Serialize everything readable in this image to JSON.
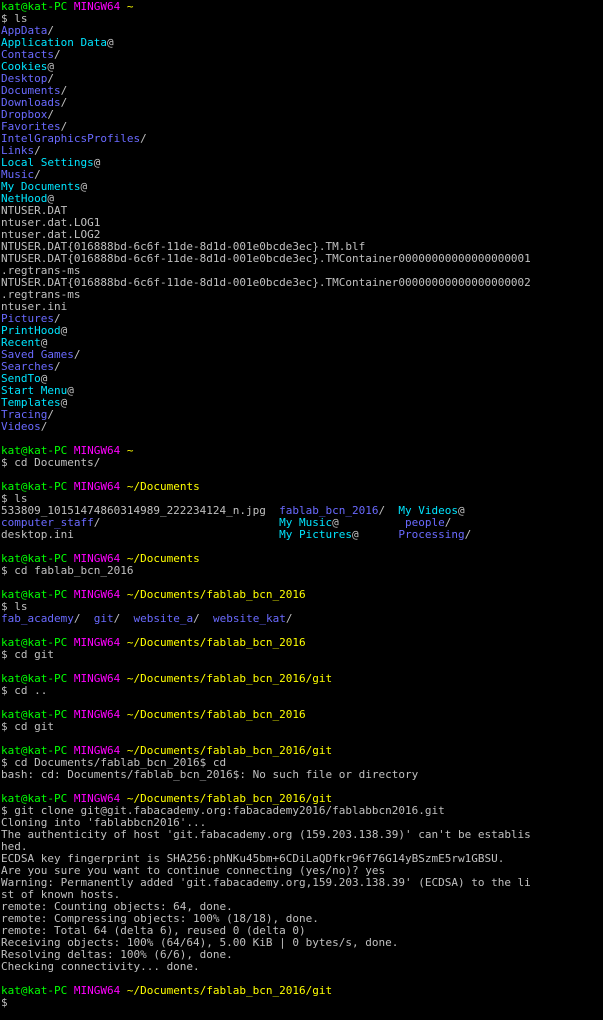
{
  "terminal": {
    "colors": {
      "background": "#000000",
      "text": "#c0c0c0",
      "user": "#00ff00",
      "mingw": "#ff00ff",
      "path": "#ffff00",
      "directory": "#6a6aff",
      "symlink": "#00e5ff"
    },
    "lines": [
      [
        [
          "kat@kat-PC ",
          "user"
        ],
        [
          "MINGW64 ",
          "mingw"
        ],
        [
          "~",
          "path"
        ]
      ],
      [
        [
          "$ ls",
          "txt"
        ]
      ],
      [
        [
          "AppData",
          "dir"
        ],
        [
          "/",
          "txt"
        ]
      ],
      [
        [
          "Application Data",
          "link"
        ],
        [
          "@",
          "txt"
        ]
      ],
      [
        [
          "Contacts",
          "dir"
        ],
        [
          "/",
          "txt"
        ]
      ],
      [
        [
          "Cookies",
          "link"
        ],
        [
          "@",
          "txt"
        ]
      ],
      [
        [
          "Desktop",
          "dir"
        ],
        [
          "/",
          "txt"
        ]
      ],
      [
        [
          "Documents",
          "dir"
        ],
        [
          "/",
          "txt"
        ]
      ],
      [
        [
          "Downloads",
          "dir"
        ],
        [
          "/",
          "txt"
        ]
      ],
      [
        [
          "Dropbox",
          "dir"
        ],
        [
          "/",
          "txt"
        ]
      ],
      [
        [
          "Favorites",
          "dir"
        ],
        [
          "/",
          "txt"
        ]
      ],
      [
        [
          "IntelGraphicsProfiles",
          "dir"
        ],
        [
          "/",
          "txt"
        ]
      ],
      [
        [
          "Links",
          "dir"
        ],
        [
          "/",
          "txt"
        ]
      ],
      [
        [
          "Local Settings",
          "link"
        ],
        [
          "@",
          "txt"
        ]
      ],
      [
        [
          "Music",
          "dir"
        ],
        [
          "/",
          "txt"
        ]
      ],
      [
        [
          "My Documents",
          "link"
        ],
        [
          "@",
          "txt"
        ]
      ],
      [
        [
          "NetHood",
          "link"
        ],
        [
          "@",
          "txt"
        ]
      ],
      [
        [
          "NTUSER.DAT",
          "txt"
        ]
      ],
      [
        [
          "ntuser.dat.LOG1",
          "txt"
        ]
      ],
      [
        [
          "ntuser.dat.LOG2",
          "txt"
        ]
      ],
      [
        [
          "NTUSER.DAT{016888bd-6c6f-11de-8d1d-001e0bcde3ec}.TM.blf",
          "txt"
        ]
      ],
      [
        [
          "NTUSER.DAT{016888bd-6c6f-11de-8d1d-001e0bcde3ec}.TMContainer00000000000000000001",
          "txt"
        ]
      ],
      [
        [
          ".regtrans-ms",
          "txt"
        ]
      ],
      [
        [
          "NTUSER.DAT{016888bd-6c6f-11de-8d1d-001e0bcde3ec}.TMContainer00000000000000000002",
          "txt"
        ]
      ],
      [
        [
          ".regtrans-ms",
          "txt"
        ]
      ],
      [
        [
          "ntuser.ini",
          "txt"
        ]
      ],
      [
        [
          "Pictures",
          "dir"
        ],
        [
          "/",
          "txt"
        ]
      ],
      [
        [
          "PrintHood",
          "link"
        ],
        [
          "@",
          "txt"
        ]
      ],
      [
        [
          "Recent",
          "link"
        ],
        [
          "@",
          "txt"
        ]
      ],
      [
        [
          "Saved Games",
          "dir"
        ],
        [
          "/",
          "txt"
        ]
      ],
      [
        [
          "Searches",
          "dir"
        ],
        [
          "/",
          "txt"
        ]
      ],
      [
        [
          "SendTo",
          "link"
        ],
        [
          "@",
          "txt"
        ]
      ],
      [
        [
          "Start Menu",
          "link"
        ],
        [
          "@",
          "txt"
        ]
      ],
      [
        [
          "Templates",
          "link"
        ],
        [
          "@",
          "txt"
        ]
      ],
      [
        [
          "Tracing",
          "dir"
        ],
        [
          "/",
          "txt"
        ]
      ],
      [
        [
          "Videos",
          "dir"
        ],
        [
          "/",
          "txt"
        ]
      ],
      [],
      [
        [
          "kat@kat-PC ",
          "user"
        ],
        [
          "MINGW64 ",
          "mingw"
        ],
        [
          "~",
          "path"
        ]
      ],
      [
        [
          "$ cd Documents/",
          "txt"
        ]
      ],
      [],
      [
        [
          "kat@kat-PC ",
          "user"
        ],
        [
          "MINGW64 ",
          "mingw"
        ],
        [
          "~/Documents",
          "path"
        ]
      ],
      [
        [
          "$ ls",
          "txt"
        ]
      ],
      [
        [
          "533809_10151474860314989_222234124_n.jpg  ",
          "txt"
        ],
        [
          "fablab_bcn_2016",
          "dir"
        ],
        [
          "/  ",
          "txt"
        ],
        [
          "My Videos",
          "link"
        ],
        [
          "@",
          "txt"
        ]
      ],
      [
        [
          "computer_staff",
          "dir"
        ],
        [
          "/                           ",
          "txt"
        ],
        [
          "My Music",
          "link"
        ],
        [
          "@          ",
          "txt"
        ],
        [
          "people",
          "dir"
        ],
        [
          "/",
          "txt"
        ]
      ],
      [
        [
          "desktop.ini                               ",
          "txt"
        ],
        [
          "My Pictures",
          "link"
        ],
        [
          "@      ",
          "txt"
        ],
        [
          "Processing",
          "dir"
        ],
        [
          "/",
          "txt"
        ]
      ],
      [],
      [
        [
          "kat@kat-PC ",
          "user"
        ],
        [
          "MINGW64 ",
          "mingw"
        ],
        [
          "~/Documents",
          "path"
        ]
      ],
      [
        [
          "$ cd fablab_bcn_2016",
          "txt"
        ]
      ],
      [],
      [
        [
          "kat@kat-PC ",
          "user"
        ],
        [
          "MINGW64 ",
          "mingw"
        ],
        [
          "~/Documents/fablab_bcn_2016",
          "path"
        ]
      ],
      [
        [
          "$ ls",
          "txt"
        ]
      ],
      [
        [
          "fab_academy",
          "dir"
        ],
        [
          "/  ",
          "txt"
        ],
        [
          "git",
          "dir"
        ],
        [
          "/  ",
          "txt"
        ],
        [
          "website_a",
          "dir"
        ],
        [
          "/  ",
          "txt"
        ],
        [
          "website_kat",
          "dir"
        ],
        [
          "/",
          "txt"
        ]
      ],
      [],
      [
        [
          "kat@kat-PC ",
          "user"
        ],
        [
          "MINGW64 ",
          "mingw"
        ],
        [
          "~/Documents/fablab_bcn_2016",
          "path"
        ]
      ],
      [
        [
          "$ cd git",
          "txt"
        ]
      ],
      [],
      [
        [
          "kat@kat-PC ",
          "user"
        ],
        [
          "MINGW64 ",
          "mingw"
        ],
        [
          "~/Documents/fablab_bcn_2016/git",
          "path"
        ]
      ],
      [
        [
          "$ cd ..",
          "txt"
        ]
      ],
      [],
      [
        [
          "kat@kat-PC ",
          "user"
        ],
        [
          "MINGW64 ",
          "mingw"
        ],
        [
          "~/Documents/fablab_bcn_2016",
          "path"
        ]
      ],
      [
        [
          "$ cd git",
          "txt"
        ]
      ],
      [],
      [
        [
          "kat@kat-PC ",
          "user"
        ],
        [
          "MINGW64 ",
          "mingw"
        ],
        [
          "~/Documents/fablab_bcn_2016/git",
          "path"
        ]
      ],
      [
        [
          "$ cd Documents/fablab_bcn_2016$ cd",
          "txt"
        ]
      ],
      [
        [
          "bash: cd: Documents/fablab_bcn_2016$: No such file or directory",
          "txt"
        ]
      ],
      [],
      [
        [
          "kat@kat-PC ",
          "user"
        ],
        [
          "MINGW64 ",
          "mingw"
        ],
        [
          "~/Documents/fablab_bcn_2016/git",
          "path"
        ]
      ],
      [
        [
          "$ git clone git@git.fabacademy.org:fabacademy2016/fablabbcn2016.git",
          "txt"
        ]
      ],
      [
        [
          "Cloning into 'fablabbcn2016'...",
          "txt"
        ]
      ],
      [
        [
          "The authenticity of host 'git.fabacademy.org (159.203.138.39)' can't be establis",
          "txt"
        ]
      ],
      [
        [
          "hed.",
          "txt"
        ]
      ],
      [
        [
          "ECDSA key fingerprint is SHA256:phNKu45bm+6CDiLaQDfkr96f76G14yBSzmE5rw1GBSU.",
          "txt"
        ]
      ],
      [
        [
          "Are you sure you want to continue connecting (yes/no)? yes",
          "txt"
        ]
      ],
      [
        [
          "Warning: Permanently added 'git.fabacademy.org,159.203.138.39' (ECDSA) to the li",
          "txt"
        ]
      ],
      [
        [
          "st of known hosts.",
          "txt"
        ]
      ],
      [
        [
          "remote: Counting objects: 64, done.",
          "txt"
        ]
      ],
      [
        [
          "remote: Compressing objects: 100% (18/18), done.",
          "txt"
        ]
      ],
      [
        [
          "remote: Total 64 (delta 6), reused 0 (delta 0)",
          "txt"
        ]
      ],
      [
        [
          "Receiving objects: 100% (64/64), 5.00 KiB | 0 bytes/s, done.",
          "txt"
        ]
      ],
      [
        [
          "Resolving deltas: 100% (6/6), done.",
          "txt"
        ]
      ],
      [
        [
          "Checking connectivity... done.",
          "txt"
        ]
      ],
      [],
      [
        [
          "kat@kat-PC ",
          "user"
        ],
        [
          "MINGW64 ",
          "mingw"
        ],
        [
          "~/Documents/fablab_bcn_2016/git",
          "path"
        ]
      ],
      [
        [
          "$",
          "txt"
        ]
      ]
    ]
  }
}
